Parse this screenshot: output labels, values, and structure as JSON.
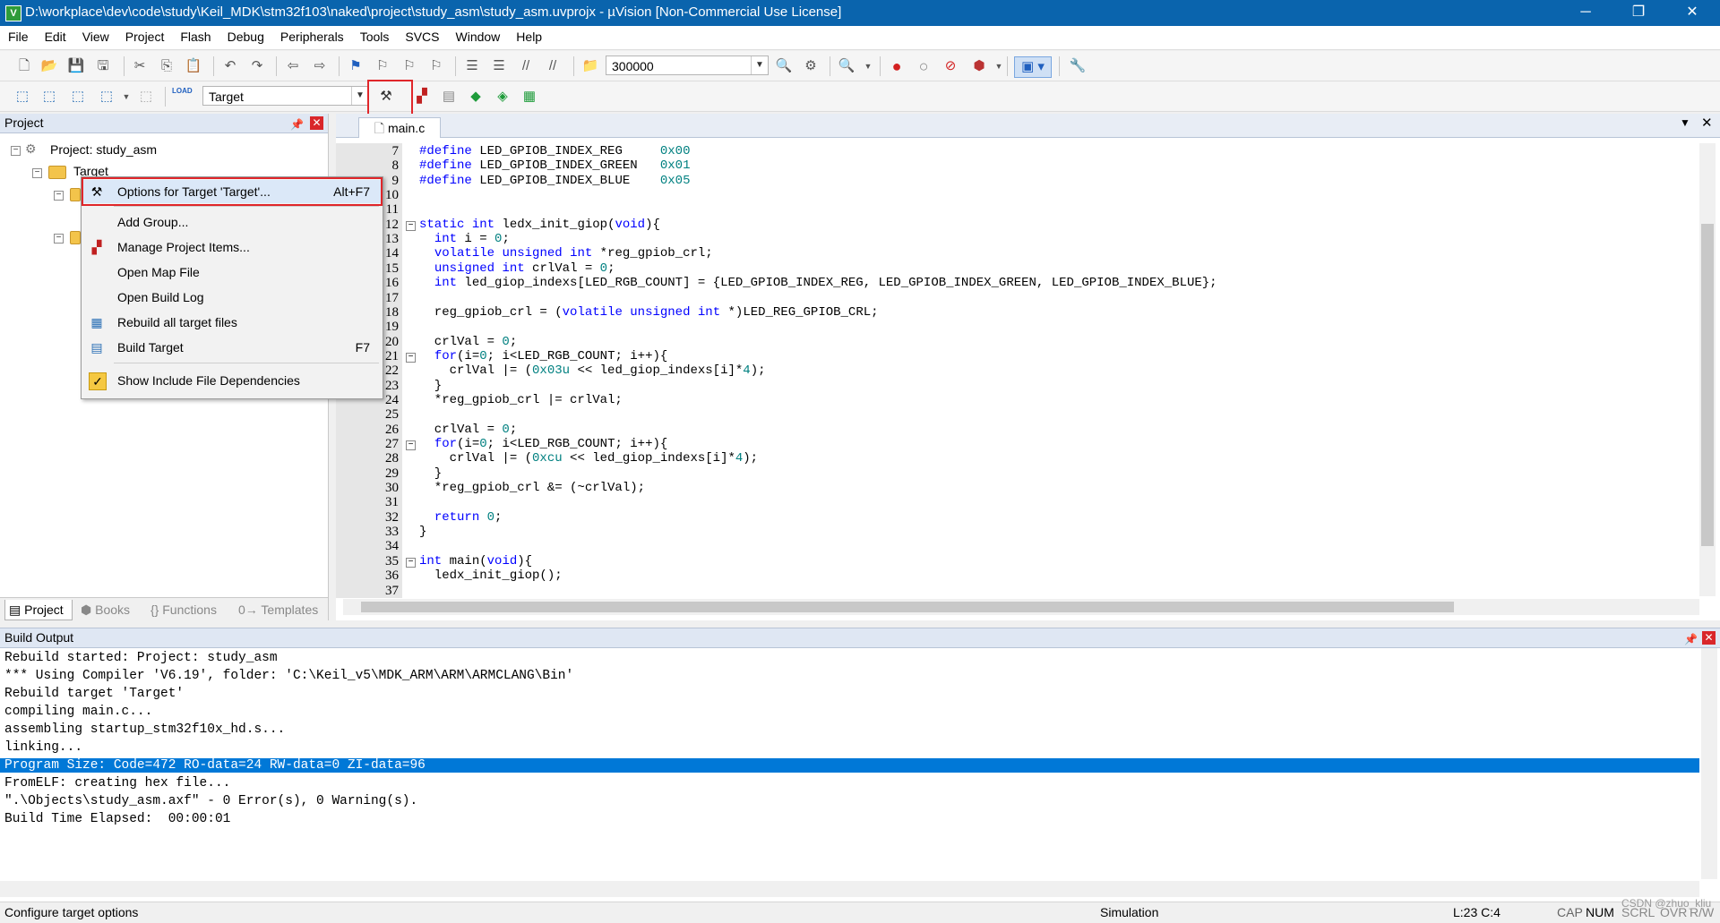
{
  "window": {
    "title": "D:\\workplace\\dev\\code\\study\\Keil_MDK\\stm32f103\\naked\\project\\study_asm\\study_asm.uvprojx - µVision  [Non-Commercial Use License]",
    "minimize": "─",
    "restore": "❐",
    "close": "✕"
  },
  "menu": [
    "File",
    "Edit",
    "View",
    "Project",
    "Flash",
    "Debug",
    "Peripherals",
    "Tools",
    "SVCS",
    "Window",
    "Help"
  ],
  "toolbar": {
    "search_value": "300000",
    "target_value": "Target",
    "load_label": "LOAD"
  },
  "project_pane": {
    "title": "Project",
    "root": "Project: study_asm",
    "target_node": "Target",
    "tabs": [
      "Project",
      "Books",
      "{} Functions",
      "0→ Templates"
    ]
  },
  "editor": {
    "file_tab": "main.c",
    "lines": [
      {
        "n": "7",
        "t": "#define LED_GPIOB_INDEX_REG     0x00"
      },
      {
        "n": "8",
        "t": "#define LED_GPIOB_INDEX_GREEN   0x01"
      },
      {
        "n": "9",
        "t": "#define LED_GPIOB_INDEX_BLUE    0x05"
      },
      {
        "n": "10",
        "t": ""
      },
      {
        "n": "11",
        "t": ""
      },
      {
        "n": "12",
        "t": "static int ledx_init_giop(void){"
      },
      {
        "n": "13",
        "t": "  int i = 0;"
      },
      {
        "n": "14",
        "t": "  volatile unsigned int *reg_gpiob_crl;"
      },
      {
        "n": "15",
        "t": "  unsigned int crlVal = 0;"
      },
      {
        "n": "16",
        "t": "  int led_giop_indexs[LED_RGB_COUNT] = {LED_GPIOB_INDEX_REG, LED_GPIOB_INDEX_GREEN, LED_GPIOB_INDEX_BLUE};"
      },
      {
        "n": "17",
        "t": ""
      },
      {
        "n": "18",
        "t": "  reg_gpiob_crl = (volatile unsigned int *)LED_REG_GPIOB_CRL;"
      },
      {
        "n": "19",
        "t": ""
      },
      {
        "n": "20",
        "t": "  crlVal = 0;"
      },
      {
        "n": "21",
        "t": "  for(i=0; i<LED_RGB_COUNT; i++){"
      },
      {
        "n": "22",
        "t": "    crlVal |= (0x03u << led_giop_indexs[i]*4);"
      },
      {
        "n": "23",
        "t": "  }"
      },
      {
        "n": "24",
        "t": "  *reg_gpiob_crl |= crlVal;"
      },
      {
        "n": "25",
        "t": ""
      },
      {
        "n": "26",
        "t": "  crlVal = 0;"
      },
      {
        "n": "27",
        "t": "  for(i=0; i<LED_RGB_COUNT; i++){"
      },
      {
        "n": "28",
        "t": "    crlVal |= (0xcu << led_giop_indexs[i]*4);"
      },
      {
        "n": "29",
        "t": "  }"
      },
      {
        "n": "30",
        "t": "  *reg_gpiob_crl &= (~crlVal);"
      },
      {
        "n": "31",
        "t": ""
      },
      {
        "n": "32",
        "t": "  return 0;"
      },
      {
        "n": "33",
        "t": "}"
      },
      {
        "n": "34",
        "t": ""
      },
      {
        "n": "35",
        "t": "int main(void){"
      },
      {
        "n": "36",
        "t": "  ledx_init_giop();"
      },
      {
        "n": "37",
        "t": ""
      }
    ]
  },
  "context_menu": {
    "items": [
      {
        "label": "Options for Target 'Target'...",
        "shortcut": "Alt+F7",
        "icon": "wand-icon"
      },
      {
        "label": "Add Group...",
        "shortcut": "",
        "icon": ""
      },
      {
        "label": "Manage Project Items...",
        "shortcut": "",
        "icon": "books-icon"
      },
      {
        "label": "Open Map File",
        "shortcut": "",
        "icon": ""
      },
      {
        "label": "Open Build Log",
        "shortcut": "",
        "icon": ""
      },
      {
        "label": "Rebuild all target files",
        "shortcut": "",
        "icon": "rebuild-icon"
      },
      {
        "label": "Build Target",
        "shortcut": "F7",
        "icon": "build-icon"
      },
      {
        "label": "Show Include File Dependencies",
        "shortcut": "",
        "icon": "check-icon"
      }
    ]
  },
  "build_output": {
    "title": "Build Output",
    "lines": [
      "Rebuild started: Project: study_asm",
      "*** Using Compiler 'V6.19', folder: 'C:\\Keil_v5\\MDK_ARM\\ARM\\ARMCLANG\\Bin'",
      "Rebuild target 'Target'",
      "compiling main.c...",
      "assembling startup_stm32f10x_hd.s...",
      "linking...",
      "Program Size: Code=472 RO-data=24 RW-data=0 ZI-data=96",
      "FromELF: creating hex file...",
      "\".\\Objects\\study_asm.axf\" - 0 Error(s), 0 Warning(s).",
      "Build Time Elapsed:  00:00:01"
    ],
    "selected_index": 6
  },
  "status": {
    "hint": "Configure target options",
    "mode": "Simulation",
    "position": "L:23 C:4",
    "cap": "CAP",
    "num": "NUM",
    "scrl": "SCRL",
    "ovr": "OVR",
    "rw": "R/W",
    "watermark": "CSDN @zhuo_kliu"
  },
  "colors": {
    "titlebar": "#0a64ad",
    "selection": "#0078d7",
    "highlight_box": "#e0262a",
    "keyword": "#0000ff",
    "number": "#008080"
  }
}
